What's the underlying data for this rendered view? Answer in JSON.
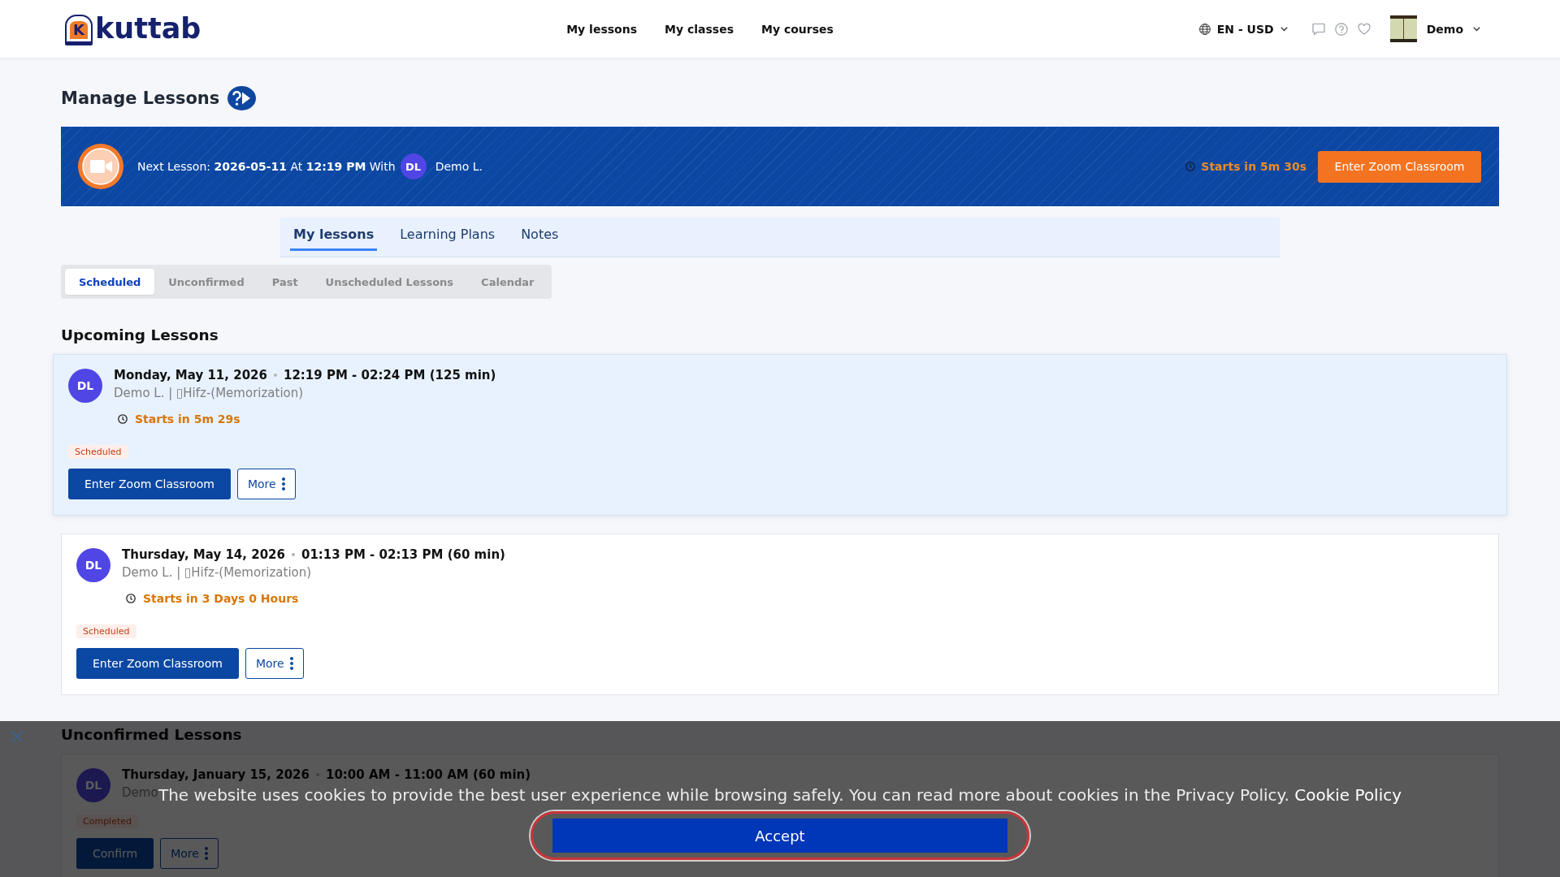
{
  "header": {
    "logo": {
      "mark": "K",
      "text": "kuttab"
    },
    "nav": [
      "My lessons",
      "My classes",
      "My courses"
    ],
    "locale": "EN - USD",
    "user": "Demo"
  },
  "page_title": "Manage Lessons",
  "next_lesson": {
    "text": "Next Lesson: **2026-05-11** At **12:19 PM** With",
    "avatar": "DL",
    "teacher": "Demo L.",
    "countdown": "Starts in 5m 30s",
    "button": "Enter Zoom Classroom"
  },
  "tabs": [
    {
      "label": "My lessons",
      "selected": true
    },
    {
      "label": "Learning Plans",
      "selected": false
    },
    {
      "label": "Notes",
      "selected": false
    }
  ],
  "subtabs": [
    {
      "label": "Scheduled",
      "selected": true
    },
    {
      "label": "Unconfirmed",
      "selected": false
    },
    {
      "label": "Past",
      "selected": false
    },
    {
      "label": "Unscheduled Lessons",
      "selected": false
    },
    {
      "label": "Calendar",
      "selected": false
    }
  ],
  "sections": [
    {
      "title": "Upcoming Lessons",
      "lessons": [
        {
          "highlighted": true,
          "avatar": "DL",
          "date": "Monday, May 11, 2026",
          "time": "12:19 PM - 02:24 PM (125 min)",
          "subtitle": "Demo L. | ▯Hifz-(Memorization)",
          "countdown": "Starts in 5m 29s",
          "status": "Scheduled",
          "actions": [
            {
              "kind": "primary",
              "label": "Enter Zoom Classroom"
            },
            {
              "kind": "more",
              "label": "More"
            }
          ]
        },
        {
          "highlighted": false,
          "avatar": "DL",
          "date": "Thursday, May 14, 2026",
          "time": "01:13 PM - 02:13 PM (60 min)",
          "subtitle": "Demo L. | ▯Hifz-(Memorization)",
          "countdown": "Starts in 3 Days 0 Hours",
          "status": "Scheduled",
          "actions": [
            {
              "kind": "primary",
              "label": "Enter Zoom Classroom"
            },
            {
              "kind": "more",
              "label": "More"
            }
          ]
        }
      ]
    },
    {
      "title": "Unconfirmed Lessons",
      "lessons": [
        {
          "highlighted": false,
          "avatar": "DL",
          "date": "Thursday, January 15, 2026",
          "time": "10:00 AM - 11:00 AM (60 min)",
          "subtitle": "Demo",
          "status": "Completed",
          "actions": [
            {
              "kind": "primary",
              "label": "Confirm"
            },
            {
              "kind": "more",
              "label": "More"
            }
          ]
        }
      ]
    }
  ],
  "cookie_notice": {
    "text": "The website uses cookies to provide the best user experience while browsing safely. You can read more about cookies in the Privacy Policy.",
    "link": "Cookie Policy",
    "button": "Accept"
  }
}
